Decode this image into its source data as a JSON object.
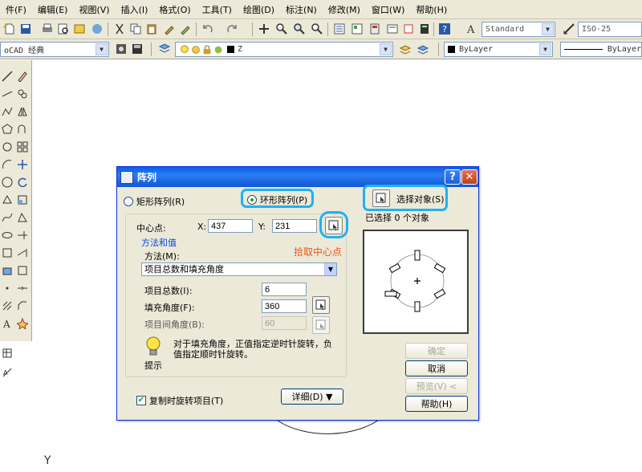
{
  "menubar": {
    "items": [
      "件(F)",
      "编辑(E)",
      "视图(V)",
      "插入(I)",
      "格式(O)",
      "工具(T)",
      "绘图(D)",
      "标注(N)",
      "修改(M)",
      "窗口(W)",
      "帮助(H)"
    ]
  },
  "toolbar": {
    "text_style": "Standard",
    "dim_style": "ISO-25",
    "workspace": "oCAD 经典",
    "layer": "Z",
    "color": "ByLayer",
    "linetype": "ByLayer"
  },
  "drawing": {
    "ucs_label": "Y"
  },
  "dialog": {
    "title": "阵列",
    "help_glyph": "?",
    "close_glyph": "✕",
    "rect_array_label": "矩形阵列(R)",
    "polar_array_label": "环形阵列(P)",
    "select_objects_label": "选择对象(S)",
    "selected_count_text": "已选择 0 个对象",
    "center_point_label": "中心点:",
    "x_label": "X:",
    "x_value": "437",
    "y_label": "Y:",
    "y_value": "231",
    "pick_center_hint": "拾取中心点",
    "method_group_label": "方法和值",
    "method_label": "方法(M):",
    "method_value": "项目总数和填充角度",
    "total_items_label": "项目总数(I):",
    "total_items_value": "6",
    "fill_angle_label": "填充角度(F):",
    "fill_angle_value": "360",
    "angle_between_label": "项目间角度(B):",
    "angle_between_value": "60",
    "tip_text_line1": "对于填充角度，正值指定逆时针旋转，负",
    "tip_text_line2": "值指定顺时针旋转。",
    "tip_label": "提示",
    "rotate_items_label": "复制时旋转项目(T)",
    "details_label": "详细(D) ▼",
    "ok_label": "确定",
    "cancel_label": "取消",
    "preview_label": "预览(V) <",
    "help_label": "帮助(H)"
  },
  "colors": {
    "titlebar": "#0a5fe8",
    "highlight": "#1fb1f2",
    "hint": "#e8561b"
  }
}
